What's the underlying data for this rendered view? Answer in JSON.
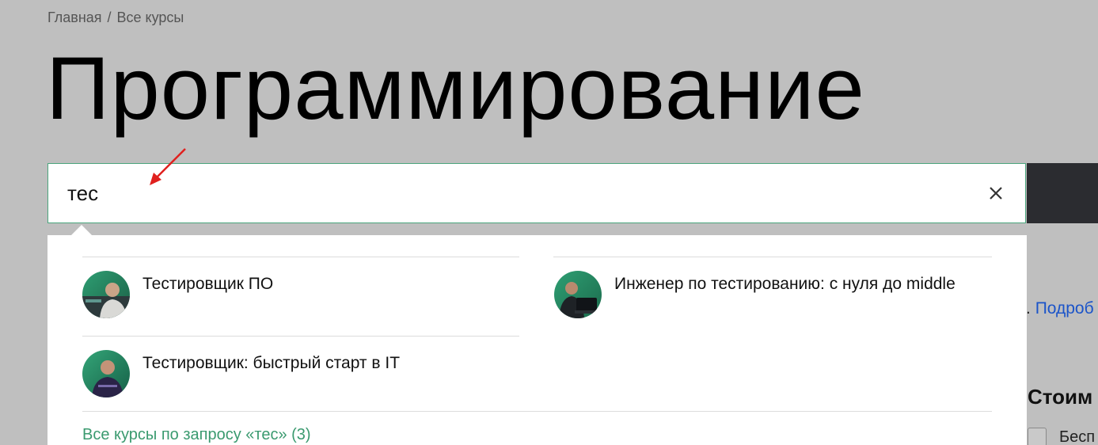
{
  "breadcrumb": {
    "home": "Главная",
    "separator": "/",
    "current": "Все курсы"
  },
  "page": {
    "title": "Программирование"
  },
  "search": {
    "value": "тес",
    "clear_icon": "close-icon"
  },
  "dropdown": {
    "courses": [
      {
        "title": "Тестировщик ПО",
        "avatar": "avatar-person-icon"
      },
      {
        "title": "Инженер по тестированию: с нуля до middle",
        "avatar": "avatar-person-laptop-icon"
      },
      {
        "title": "Тестировщик: быстрый старт в IT",
        "avatar": "avatar-person-icon"
      }
    ],
    "all_results_link": "Все курсы по запросу «тес» (3)"
  },
  "background": {
    "more_link_prefix": ".",
    "more_link": "Подроб",
    "price_heading": "Стоим",
    "checkbox_label": "Бесп"
  },
  "colors": {
    "overlay": "#bfbfbf",
    "accent_green": "#3a9a6f",
    "link_blue": "#1b54c9",
    "submit_dark": "#2b2c30",
    "arrow_red": "#e0201e"
  }
}
